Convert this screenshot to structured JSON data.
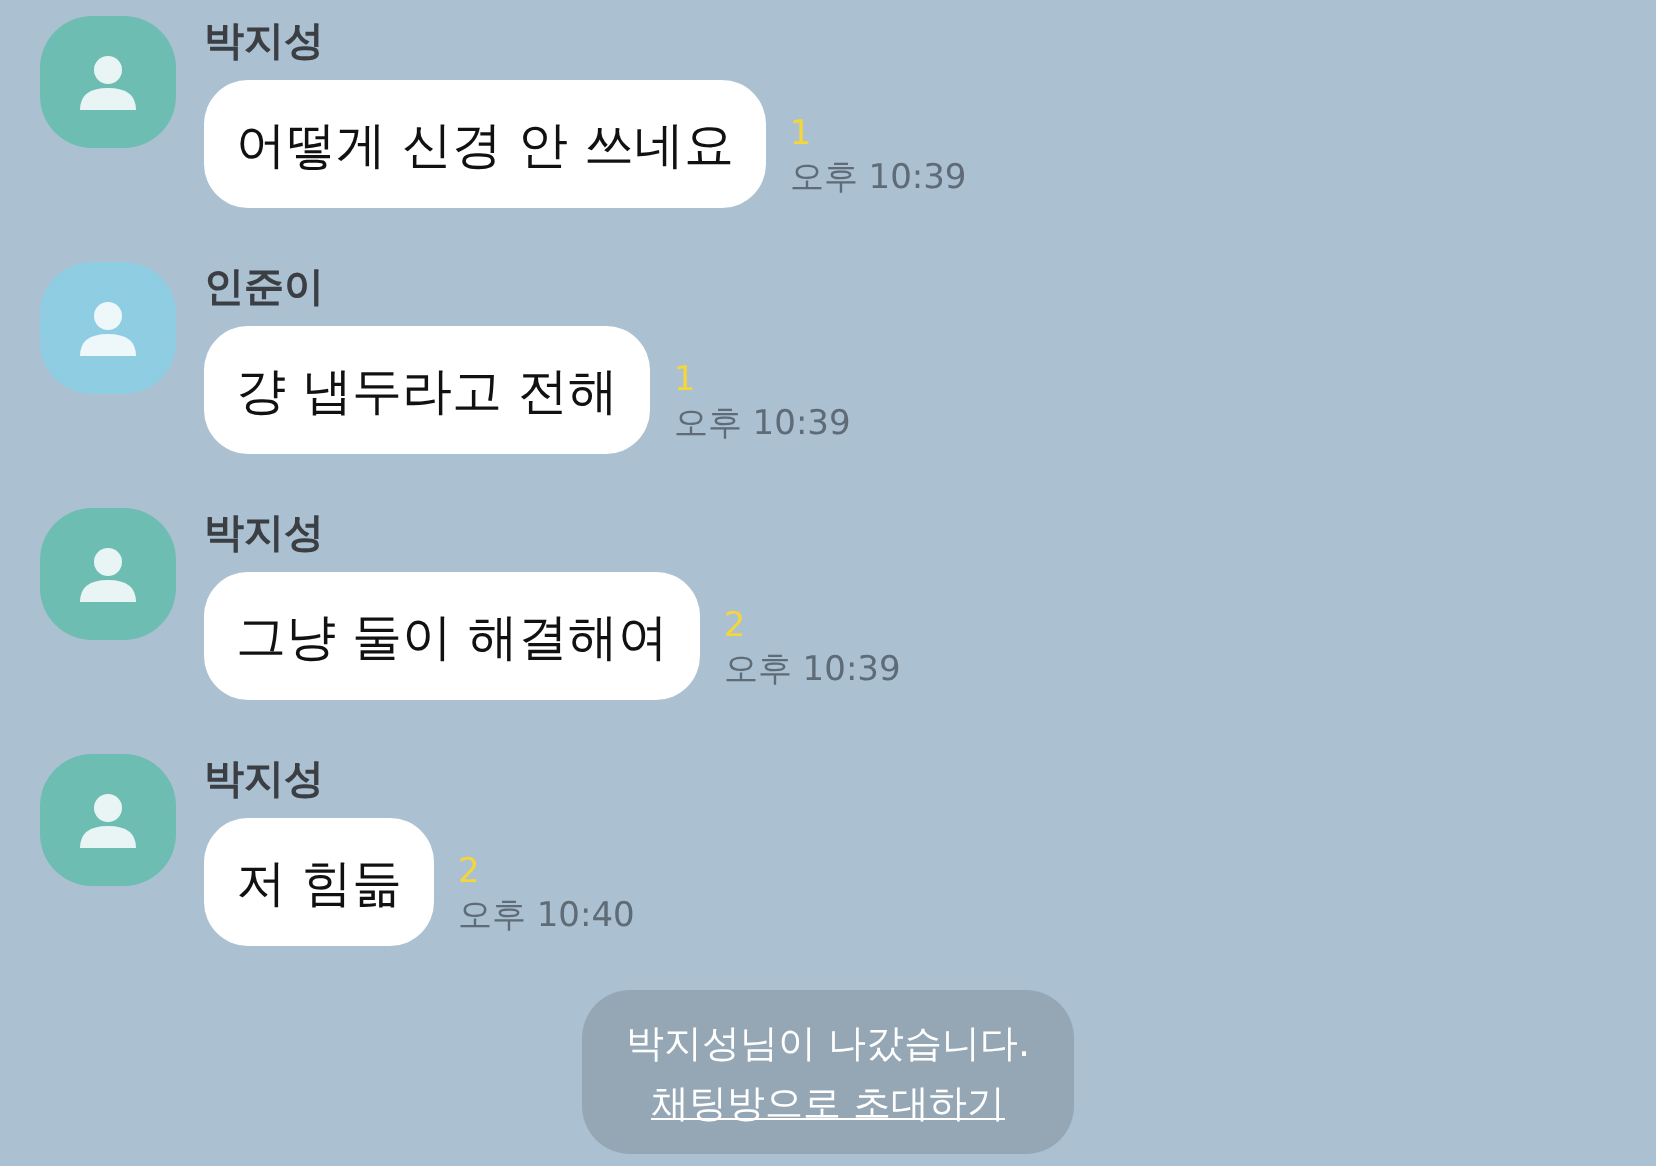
{
  "messages": [
    {
      "sender": "박지성",
      "color": "#6dbdb3",
      "text": "어떻게 신경 안 쓰네요",
      "unread": "1",
      "time": "오후 10:39"
    },
    {
      "sender": "인준이",
      "color": "#8fcde3",
      "text": "걍 냅두라고 전해",
      "unread": "1",
      "time": "오후 10:39"
    },
    {
      "sender": "박지성",
      "color": "#6dbdb3",
      "text": "그냥 둘이 해결해여",
      "unread": "2",
      "time": "오후 10:39"
    },
    {
      "sender": "박지성",
      "color": "#6dbdb3",
      "text": "저 힘듦",
      "unread": "2",
      "time": "오후 10:40"
    }
  ],
  "notice": {
    "text": "박지성님이 나갔습니다.",
    "link": "채팅방으로 초대하기"
  }
}
